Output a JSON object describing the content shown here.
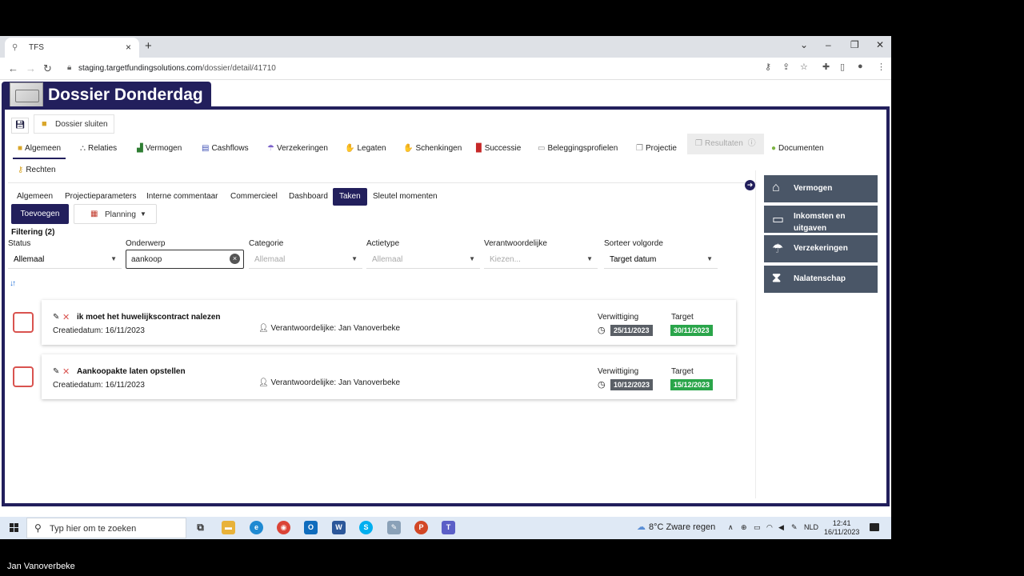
{
  "browser": {
    "tab_title": "TFS",
    "url_domain": "staging.targetfundingsolutions.com",
    "url_path": "/dossier/detail/41710"
  },
  "app": {
    "title": "Dossier Donderdag",
    "close_dossier": "Dossier sluiten"
  },
  "main_tabs": [
    {
      "label": "Algemeen",
      "icon": "folder-icon"
    },
    {
      "label": "Relaties",
      "icon": "relations-icon"
    },
    {
      "label": "Vermogen",
      "icon": "chart-icon"
    },
    {
      "label": "Cashflows",
      "icon": "cashflow-icon"
    },
    {
      "label": "Verzekeringen",
      "icon": "umbrella-icon"
    },
    {
      "label": "Legaten",
      "icon": "legacy-icon"
    },
    {
      "label": "Schenkingen",
      "icon": "gift-icon"
    },
    {
      "label": "Successie",
      "icon": "document-icon"
    },
    {
      "label": "Beleggingsprofielen",
      "icon": "profile-icon"
    },
    {
      "label": "Projectie",
      "icon": "projection-icon"
    },
    {
      "label": "Resultaten",
      "icon": "results-icon"
    },
    {
      "label": "Documenten",
      "icon": "documents-icon"
    },
    {
      "label": "Rechten",
      "icon": "key-icon"
    }
  ],
  "sub_tabs": [
    "Algemeen",
    "Projectieparameters",
    "Interne commentaar",
    "Commercieel",
    "Dashboard",
    "Taken",
    "Sleutel momenten"
  ],
  "toolbar": {
    "add_label": "Toevoegen",
    "planning_label": "Planning"
  },
  "filter": {
    "title": "Filtering (2)",
    "labels": {
      "status": "Status",
      "subject": "Onderwerp",
      "category": "Categorie",
      "action_type": "Actietype",
      "responsible": "Verantwoordelijke",
      "sort": "Sorteer volgorde"
    },
    "values": {
      "status": "Allemaal",
      "subject": "aankoop",
      "category": "Allemaal",
      "action_type": "Allemaal",
      "responsible": "Kiezen...",
      "sort": "Target datum"
    }
  },
  "tasks": [
    {
      "title": "ik moet het huwelijkscontract nalezen",
      "created": "Creatiedatum: 16/11/2023",
      "responsible": "Verantwoordelijke: Jan Vanoverbeke",
      "notice_label": "Verwittiging",
      "notice_date": "25/11/2023",
      "target_label": "Target",
      "target_date": "30/11/2023"
    },
    {
      "title": "Aankoopakte laten opstellen",
      "created": "Creatiedatum: 16/11/2023",
      "responsible": "Verantwoordelijke: Jan Vanoverbeke",
      "notice_label": "Verwittiging",
      "notice_date": "10/12/2023",
      "target_label": "Target",
      "target_date": "15/12/2023"
    }
  ],
  "side_buttons": [
    {
      "label": "Vermogen",
      "icon": "home-icon"
    },
    {
      "label": "Inkomsten en uitgaven",
      "icon": "card-icon"
    },
    {
      "label": "Verzekeringen",
      "icon": "umbrella-icon"
    },
    {
      "label": "Nalatenschap",
      "icon": "hourglass-icon"
    }
  ],
  "taskbar": {
    "search_placeholder": "Typ hier om te zoeken",
    "weather": "8°C  Zware regen",
    "language": "NLD",
    "time": "12:41",
    "date": "16/11/2023"
  },
  "caption": "Jan Vanoverbeke",
  "colors": {
    "brand": "#221f5c",
    "side_button": "#4a5667",
    "target_badge": "#2aa54a",
    "notice_badge": "#5a5f66",
    "checkbox_border": "#d9534f"
  }
}
